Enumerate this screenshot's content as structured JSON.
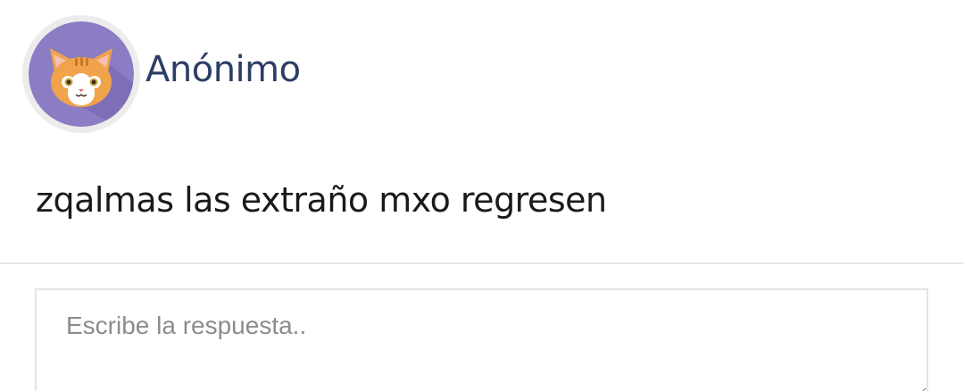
{
  "post": {
    "author": "Anónimo",
    "avatar_icon": "cat-avatar-icon",
    "message": "zqalmas las extraño mxo regresen"
  },
  "reply": {
    "value": "",
    "placeholder": "Escribe la respuesta.."
  },
  "colors": {
    "author": "#2c3e63",
    "avatar_bg": "#8b7cc4",
    "divider": "#e6e6e6"
  }
}
